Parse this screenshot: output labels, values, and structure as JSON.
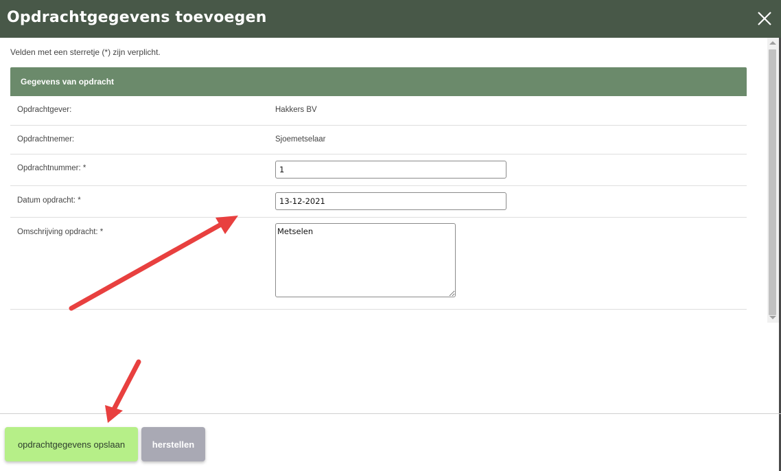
{
  "dialog": {
    "title": "Opdrachtgegevens toevoegen",
    "close_icon": "close-icon"
  },
  "intro_text": "Velden met een sterretje (*) zijn verplicht.",
  "panel": {
    "header": "Gegevens van opdracht",
    "rows": [
      {
        "label": "Opdrachtgever:",
        "value": "Hakkers BV"
      },
      {
        "label": "Opdrachtnemer:",
        "value": "Sjoemetselaar"
      },
      {
        "label": "Opdrachtnummer: *",
        "value": "1"
      },
      {
        "label": "Datum opdracht: *",
        "value": "13-12-2021"
      },
      {
        "label": "Omschrijving opdracht: *",
        "value": "Metselen"
      }
    ]
  },
  "buttons": {
    "save": "opdrachtgegevens opslaan",
    "reset": "herstellen"
  },
  "colors": {
    "titlebar": "#485848",
    "panel_header": "#6b8a6b",
    "save_button": "#b6ef88",
    "reset_button": "#a9a9b4",
    "annotation_arrow": "#e8403f"
  }
}
